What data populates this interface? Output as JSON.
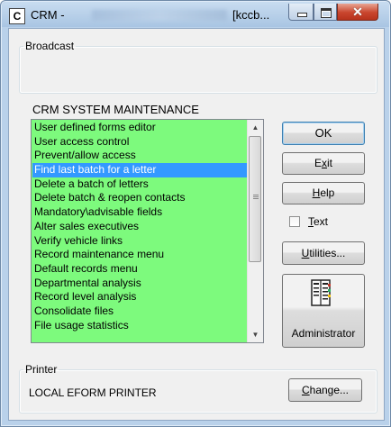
{
  "window": {
    "icon_letter": "C",
    "title_prefix": "CRM -",
    "title_suffix": "[kccb..."
  },
  "broadcast": {
    "label": "Broadcast"
  },
  "maintenance": {
    "title": "CRM SYSTEM MAINTENANCE",
    "items": [
      "User defined forms editor",
      "User access control",
      "Prevent/allow access",
      "Find last batch for a letter",
      "Delete a batch of letters",
      "Delete batch & reopen contacts",
      "Mandatory\\advisable fields",
      "Alter sales executives",
      "Verify vehicle links",
      "Record maintenance menu",
      "Default records menu",
      "Departmental analysis",
      "Record level analysis",
      "Consolidate files",
      "File usage statistics"
    ],
    "selected_index": 3,
    "list_background": "#7dfa7d",
    "selection_color": "#3399ff"
  },
  "buttons": {
    "ok": "OK",
    "exit": "Exit",
    "help": "Help",
    "text_checkbox": "Text",
    "text_checked": false,
    "utilities": "Utilities...",
    "administrator": "Administrator",
    "administrator_icon": "ledger-book-icon",
    "change": "Change..."
  },
  "printer": {
    "label": "Printer",
    "name": "LOCAL EFORM PRINTER"
  }
}
